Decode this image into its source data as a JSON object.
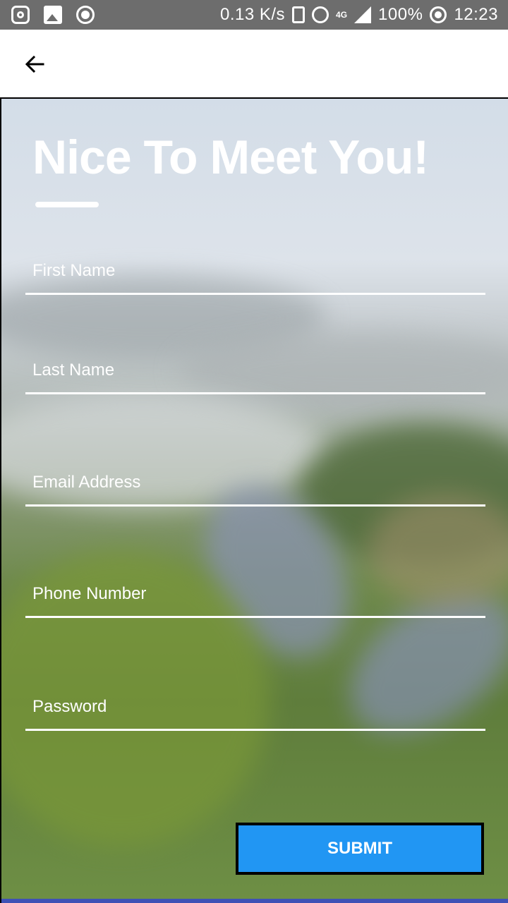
{
  "status_bar": {
    "speed": "0.13 K/s",
    "network_type": "4G",
    "battery": "100%",
    "time": "12:23",
    "icons": [
      "instagram-icon",
      "gallery-icon",
      "record-icon",
      "vibrate-icon",
      "alarm-icon",
      "signal-icon",
      "battery-saver-icon"
    ]
  },
  "app_bar": {
    "back_icon": "arrow-left-icon"
  },
  "form": {
    "title": "Nice To Meet You!",
    "fields": [
      {
        "placeholder": "First Name"
      },
      {
        "placeholder": "Last Name"
      },
      {
        "placeholder": "Email Address"
      },
      {
        "placeholder": "Phone Number"
      },
      {
        "placeholder": "Password"
      }
    ],
    "submit_label": "SUBMIT"
  },
  "colors": {
    "accent": "#2196f3",
    "status_bar": "#6d6d6d"
  }
}
